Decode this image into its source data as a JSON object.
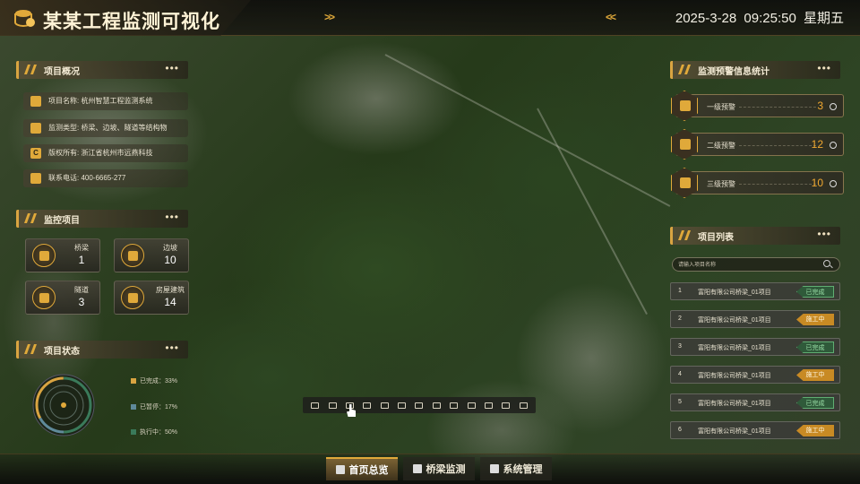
{
  "header": {
    "title": "某某工程监测可视化",
    "arrows_left": ">>",
    "arrows_right": "<<",
    "date": "2025-3-28",
    "time": "09:25:50",
    "weekday": "星期五"
  },
  "overview": {
    "title": "项目概况",
    "rows": [
      {
        "icon": "doc-icon",
        "text": "项目名称: 杭州智慧工程监测系统"
      },
      {
        "icon": "monitor-icon",
        "text": "监测类型: 桥梁、边坡、隧道等结构物"
      },
      {
        "icon": "copyright-icon",
        "text": "版权所有: 浙江省杭州市远燕科技"
      },
      {
        "icon": "phone-icon",
        "text": "联系电话: 400-6665-277"
      }
    ]
  },
  "monitor": {
    "title": "监控项目",
    "items": [
      {
        "name": "桥梁",
        "value": "1",
        "icon": "bridge-icon"
      },
      {
        "name": "边坡",
        "value": "10",
        "icon": "slope-icon"
      },
      {
        "name": "隧道",
        "value": "3",
        "icon": "tunnel-icon"
      },
      {
        "name": "房屋建筑",
        "value": "14",
        "icon": "building-icon"
      }
    ]
  },
  "status": {
    "title": "项目状态",
    "legend": [
      {
        "label": "已完成：33%",
        "color": "#d9a441"
      },
      {
        "label": "已暂停：17%",
        "color": "#5f8a9a"
      },
      {
        "label": "执行中：50%",
        "color": "#3a7a5a"
      }
    ]
  },
  "warnings": {
    "title": "监测预警信息统计",
    "items": [
      {
        "label": "一级预警",
        "value": "3"
      },
      {
        "label": "二级预警",
        "value": "12"
      },
      {
        "label": "三级预警",
        "value": "10"
      }
    ]
  },
  "projects": {
    "title": "项目列表",
    "search_placeholder": "请输入项目名称",
    "rows": [
      {
        "no": "1",
        "name": "富阳有限公司桥梁_01项目",
        "status": "已完成",
        "type": "done"
      },
      {
        "no": "2",
        "name": "富阳有限公司桥梁_01项目",
        "status": "施工中",
        "type": "work"
      },
      {
        "no": "3",
        "name": "富阳有限公司桥梁_01项目",
        "status": "已完成",
        "type": "done"
      },
      {
        "no": "4",
        "name": "富阳有限公司桥梁_01项目",
        "status": "施工中",
        "type": "work"
      },
      {
        "no": "5",
        "name": "富阳有限公司桥梁_01项目",
        "status": "已完成",
        "type": "done"
      },
      {
        "no": "6",
        "name": "富阳有限公司桥梁_01项目",
        "status": "施工中",
        "type": "work"
      }
    ]
  },
  "nav": {
    "tabs": [
      {
        "label": "首页总览",
        "icon": "home-icon",
        "active": true
      },
      {
        "label": "桥梁监测",
        "icon": "bridge-icon",
        "active": false
      },
      {
        "label": "系统管理",
        "icon": "settings-icon",
        "active": false
      }
    ]
  },
  "dots": "•••"
}
